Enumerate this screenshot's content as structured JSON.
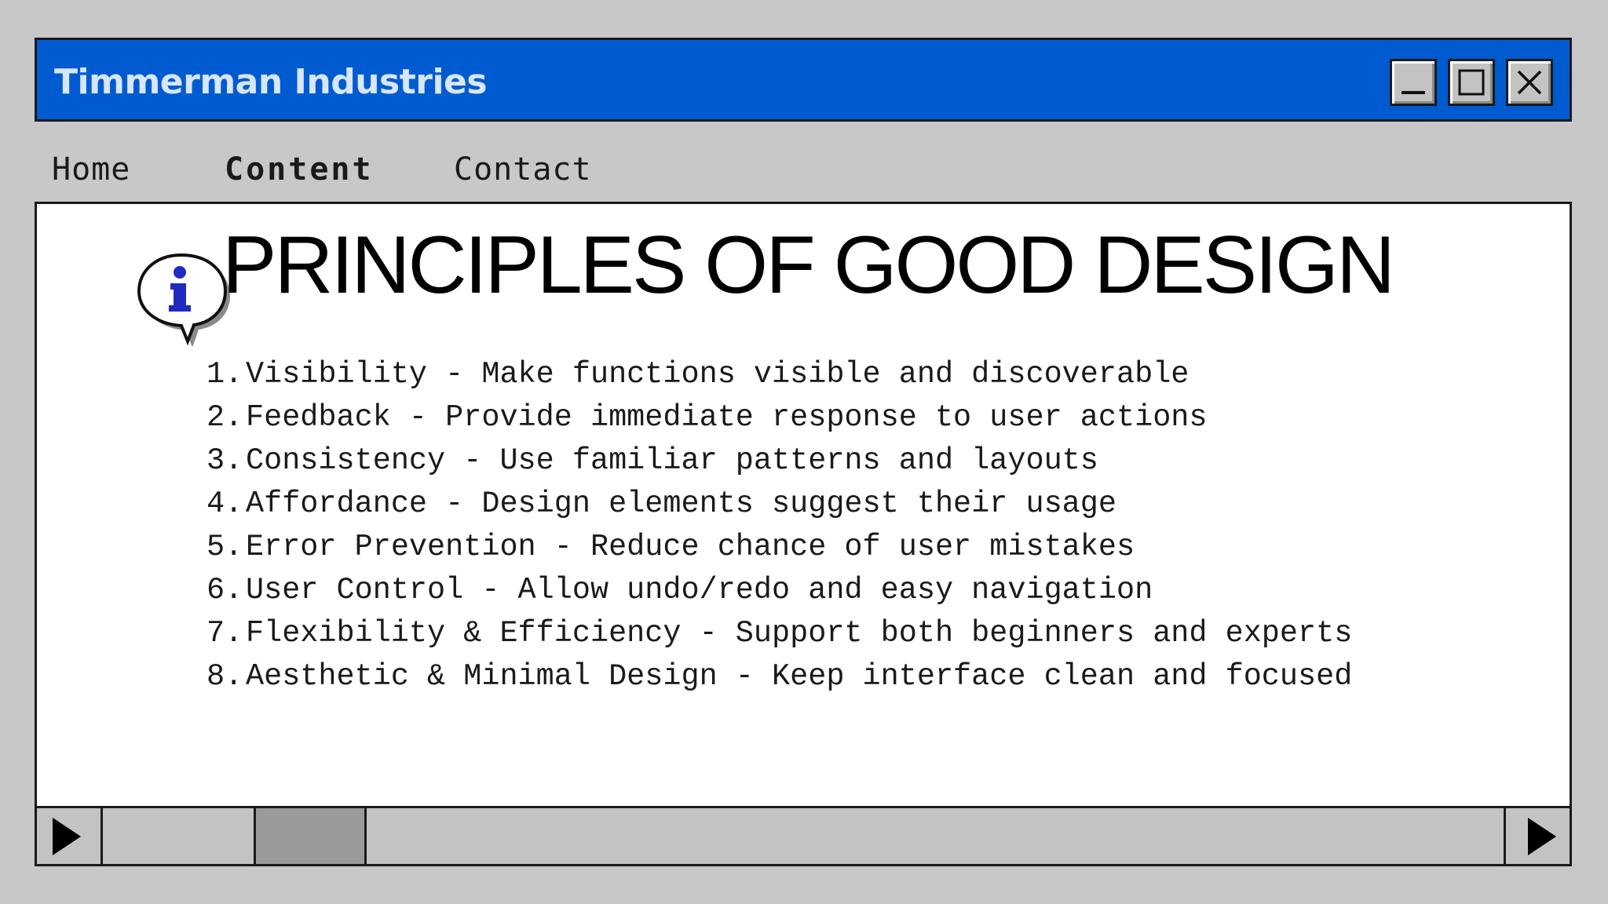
{
  "window": {
    "title": "Timmerman Industries",
    "accent_color": "#005bd0",
    "controls": {
      "minimize_icon": "minimize-icon",
      "maximize_icon": "maximize-icon",
      "close_icon": "close-icon"
    }
  },
  "nav": {
    "tabs": [
      {
        "label": "Home",
        "active": false
      },
      {
        "label": "Content",
        "active": true
      },
      {
        "label": "Contact",
        "active": false
      }
    ]
  },
  "main": {
    "icon": "info-icon",
    "title": "PRINCIPLES OF GOOD DESIGN",
    "principles": [
      {
        "num": "1.",
        "text": "Visibility - Make functions visible and discoverable"
      },
      {
        "num": "2.",
        "text": "Feedback - Provide immediate response to user actions"
      },
      {
        "num": "3.",
        "text": "Consistency - Use familiar patterns and layouts"
      },
      {
        "num": "4.",
        "text": "Affordance - Design elements suggest their usage"
      },
      {
        "num": "5.",
        "text": "Error Prevention - Reduce chance of user mistakes"
      },
      {
        "num": "6.",
        "text": "User Control - Allow undo/redo and easy navigation"
      },
      {
        "num": "7.",
        "text": "Flexibility & Efficiency - Support both beginners and experts"
      },
      {
        "num": "8.",
        "text": "Aesthetic & Minimal Design - Keep interface clean and focused"
      }
    ]
  },
  "scrollbar": {
    "left_arrow_icon": "play-left-icon",
    "right_arrow_icon": "play-right-icon"
  }
}
